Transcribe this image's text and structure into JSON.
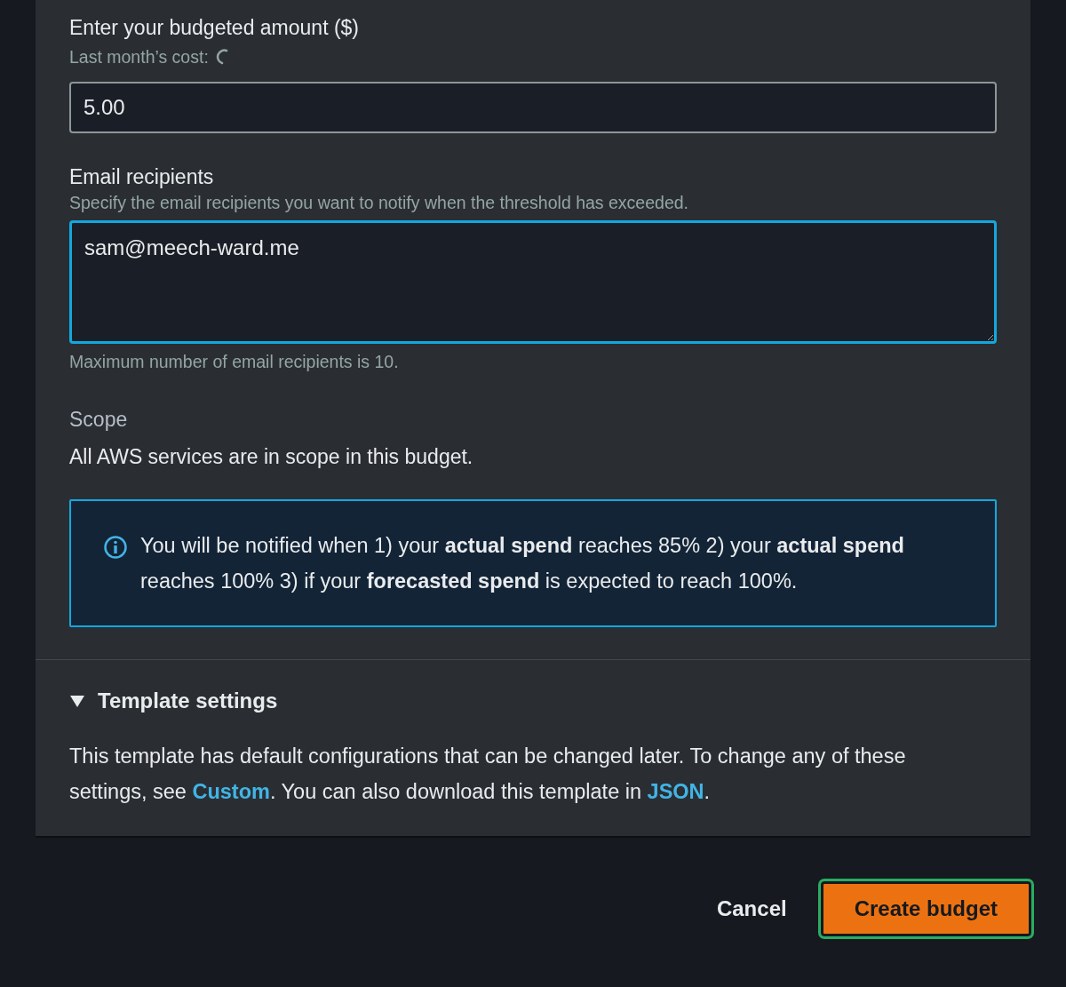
{
  "budget_amount": {
    "label": "Enter your budgeted amount ($)",
    "hint": "Last month’s cost:",
    "loading": true,
    "value": "5.00"
  },
  "email_recipients": {
    "label": "Email recipients",
    "description": "Specify the email recipients you want to notify when the threshold has exceeded.",
    "value": "sam@meech-ward.me",
    "focused": true,
    "constraint": "Maximum number of email recipients is 10."
  },
  "scope": {
    "label": "Scope",
    "text": "All AWS services are in scope in this budget."
  },
  "info_alert": {
    "text": "You will be notified when 1) your **actual spend** reaches 85% 2) your **actual spend** reaches 100% 3) if your **forecasted spend** is expected to reach 100%."
  },
  "template_settings": {
    "title": "Template settings",
    "expanded": true,
    "description": [
      {
        "kind": "text",
        "text": "This template has default configurations that can be changed later. To change any of these settings, see "
      },
      {
        "kind": "link",
        "text": "Custom"
      },
      {
        "kind": "text",
        "text": ". You can also download this template in "
      },
      {
        "kind": "link",
        "text": "JSON"
      },
      {
        "kind": "text",
        "text": "."
      }
    ]
  },
  "actions": [
    {
      "label": "Cancel",
      "kind": "secondary",
      "focused": false
    },
    {
      "label": "Create budget",
      "kind": "primary",
      "focused": true
    }
  ]
}
